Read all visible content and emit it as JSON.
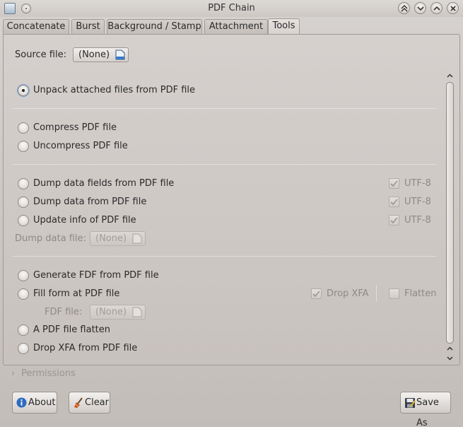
{
  "window": {
    "title": "PDF Chain"
  },
  "tabs": [
    {
      "label": "Concatenate",
      "active": false
    },
    {
      "label": "Burst",
      "active": false
    },
    {
      "label": "Background / Stamp",
      "active": false
    },
    {
      "label": "Attachment",
      "active": false
    },
    {
      "label": "Tools",
      "active": true
    }
  ],
  "source": {
    "label": "Source file:",
    "value": "(None)"
  },
  "options": {
    "unpack": {
      "label": "Unpack attached files from PDF file",
      "checked": true
    },
    "compress": {
      "label": "Compress PDF file",
      "checked": false
    },
    "uncompress": {
      "label": "Uncompress PDF file",
      "checked": false
    },
    "dump_fields": {
      "label": "Dump data fields from PDF file",
      "checked": false,
      "utf8_label": "UTF-8",
      "utf8_checked": true
    },
    "dump_data": {
      "label": "Dump data from PDF file",
      "checked": false,
      "utf8_label": "UTF-8",
      "utf8_checked": true
    },
    "update_info": {
      "label": "Update info of PDF file",
      "checked": false,
      "utf8_label": "UTF-8",
      "utf8_checked": true
    },
    "generate_fdf": {
      "label": "Generate FDF from PDF file",
      "checked": false
    },
    "fill_form": {
      "label": "Fill form at PDF file",
      "checked": false,
      "drop_xfa_label": "Drop XFA",
      "drop_xfa_checked": true,
      "flatten_label": "Flatten",
      "flatten_checked": false
    },
    "flatten": {
      "label": "A PDF file flatten",
      "checked": false
    },
    "drop_xfa": {
      "label": "Drop XFA from PDF file",
      "checked": false
    }
  },
  "dump_file": {
    "label": "Dump data file:",
    "value": "(None)"
  },
  "fdf_file": {
    "label": "FDF file:",
    "value": "(None)"
  },
  "permissions": {
    "label": "Permissions"
  },
  "buttons": {
    "about": "About",
    "clear": "Clear",
    "save_as": "Save As"
  },
  "icons": {
    "app": "pdf-chain-app-icon",
    "menu": "window-menu-icon",
    "keep_above": "keep-above-icon",
    "minimize": "minimize-icon",
    "maximize": "maximize-icon",
    "close": "close-icon",
    "file": "open-file-icon",
    "info": "info-icon",
    "clear": "clear-broom-icon",
    "save": "save-as-icon"
  },
  "colors": {
    "background": "#cdc8c4",
    "accent": "#3a78c8",
    "disabled_text": "#8f8985"
  }
}
